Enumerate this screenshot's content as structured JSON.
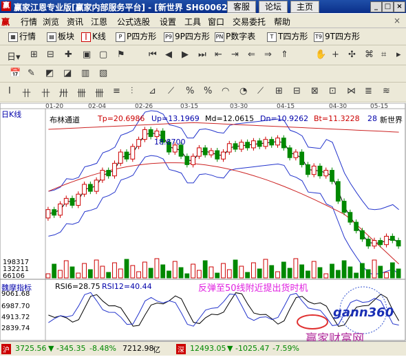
{
  "window": {
    "title": "赢家江恩专业版[赢家内部服务平台] - [新世界 SH60062",
    "tabs": [
      "客服",
      "论坛",
      "主页"
    ]
  },
  "menu": [
    "行情",
    "浏览",
    "资讯",
    "江恩",
    "公式选股",
    "设置",
    "工具",
    "窗口",
    "交易委托",
    "帮助"
  ],
  "toolbar1": [
    {
      "icon": "grid-icon",
      "label": "行情"
    },
    {
      "icon": "block-icon",
      "label": "板块"
    },
    {
      "icon": "kline-icon",
      "label": "K线"
    },
    {
      "icon": "p-icon",
      "label": "P四方形"
    },
    {
      "icon": "p9-icon",
      "label": "9P四方形"
    },
    {
      "icon": "pn-icon",
      "label": "P数字表"
    },
    {
      "icon": "t-icon",
      "label": "T四方形"
    },
    {
      "icon": "t9-icon",
      "label": "9T四方形"
    }
  ],
  "chart": {
    "period": "日K线",
    "indicator": "布林通道",
    "tp": "Tp=20.6986",
    "up": "Up=13.1969",
    "md": "Md=12.0615",
    "dn": "Dn=10.9262",
    "bt": "Bt=11.3228",
    "day_count": "28",
    "stock_name": "新世界",
    "peak_label": "18.8700",
    "dates": [
      "01-20",
      "02-04",
      "02-26",
      "03-15",
      "03-30",
      "04-15",
      "04-30",
      "05-15"
    ],
    "volume_ticks": [
      "198317",
      "132211",
      "66106"
    ],
    "annotation": "反弹至50线附近提出货时机",
    "watermark_logo": "gann360",
    "watermark_text": "赢家财富网"
  },
  "sub_indicator": {
    "name": "魏摩指标",
    "rsi6": "RSI6=28.75",
    "rsi12": "RSI12=40.44",
    "ticks": [
      "9061.68",
      "6987.70",
      "4913.72",
      "2839.74"
    ]
  },
  "status_bar": {
    "sh_value": "3725.56",
    "sh_change": "-345.35",
    "sh_pct": "-8.48%",
    "sh_amount": "7212.98",
    "sz_value": "12493.05",
    "sz_change": "-1025.47",
    "sz_pct": "-7.59%"
  },
  "chart_data": {
    "type": "candlestick",
    "title": "",
    "price_series": [
      [
        12.2,
        12.8
      ],
      [
        12.8,
        12.4
      ],
      [
        12.4,
        13.2
      ],
      [
        13.2,
        13.6
      ],
      [
        13.6,
        13.1
      ],
      [
        13.1,
        13.9
      ],
      [
        13.9,
        14.6
      ],
      [
        14.6,
        14.1
      ],
      [
        14.1,
        14.9
      ],
      [
        14.9,
        15.6
      ],
      [
        15.6,
        15.2
      ],
      [
        15.2,
        16.1
      ],
      [
        16.1,
        16.9
      ],
      [
        16.9,
        16.4
      ],
      [
        16.4,
        17.3
      ],
      [
        17.3,
        17.8
      ],
      [
        17.8,
        18.5
      ],
      [
        18.5,
        18.0
      ],
      [
        18.0,
        18.4
      ],
      [
        18.4,
        17.6
      ],
      [
        17.6,
        16.9
      ],
      [
        16.9,
        17.4
      ],
      [
        17.4,
        16.6
      ],
      [
        16.6,
        16.0
      ],
      [
        16.0,
        16.6
      ],
      [
        16.6,
        17.2
      ],
      [
        17.2,
        16.7
      ],
      [
        16.7,
        17.0
      ],
      [
        17.0,
        16.4
      ],
      [
        16.4,
        16.9
      ],
      [
        16.9,
        17.5
      ],
      [
        17.5,
        17.1
      ],
      [
        17.1,
        17.6
      ],
      [
        17.6,
        17.2
      ],
      [
        17.2,
        17.7
      ],
      [
        17.7,
        17.3
      ],
      [
        17.3,
        17.8
      ],
      [
        17.8,
        17.4
      ],
      [
        17.4,
        17.9
      ],
      [
        17.9,
        17.2
      ],
      [
        17.2,
        16.5
      ],
      [
        16.5,
        16.9
      ],
      [
        16.9,
        16.0
      ],
      [
        16.0,
        15.3
      ],
      [
        15.3,
        15.9
      ],
      [
        15.9,
        15.2
      ],
      [
        15.2,
        15.6
      ],
      [
        15.6,
        14.8
      ],
      [
        14.8,
        13.4
      ],
      [
        13.4,
        12.6
      ],
      [
        12.6,
        11.9
      ],
      [
        11.9,
        11.3
      ],
      [
        11.3,
        10.7
      ],
      [
        10.7,
        10.2
      ],
      [
        10.2,
        10.6
      ],
      [
        10.6,
        10.3
      ],
      [
        10.3,
        10.9
      ],
      [
        10.9,
        10.6
      ],
      [
        10.6,
        10.2
      ]
    ],
    "price_range": [
      9.5,
      19.5
    ]
  }
}
